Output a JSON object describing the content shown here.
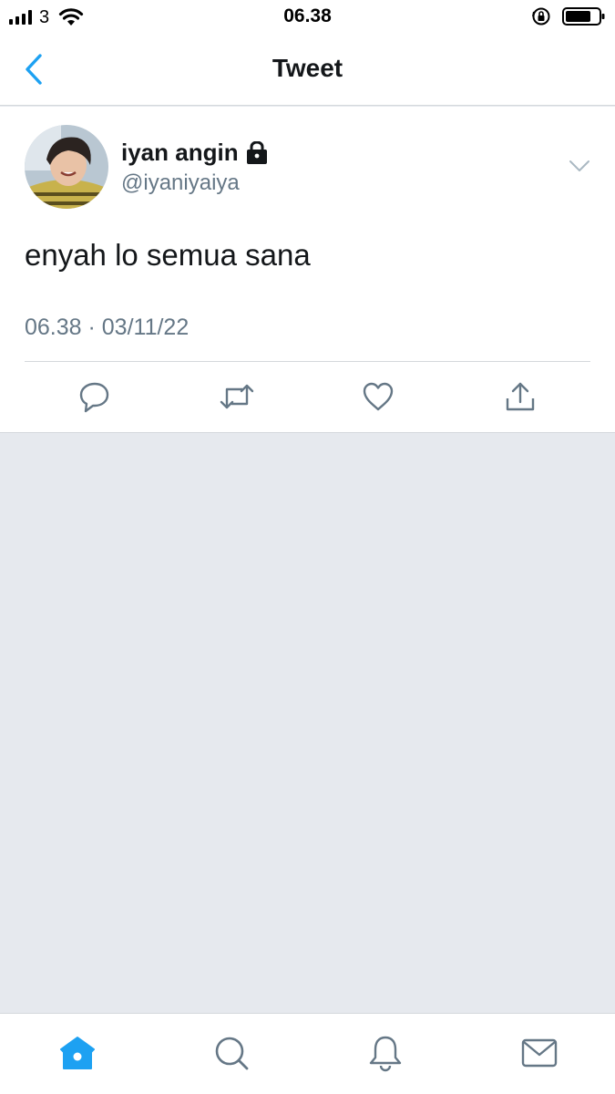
{
  "status_bar": {
    "carrier": "3",
    "time": "06.38"
  },
  "nav": {
    "title": "Tweet",
    "back_icon": "chevron-left-icon"
  },
  "tweet": {
    "display_name": "iyan angin",
    "protected_icon": "lock-icon",
    "handle": "@iyaniyaiya",
    "text": "enyah lo semua sana",
    "timestamp": "06.38 · 03/11/22",
    "actions": [
      "reply-icon",
      "retweet-icon",
      "like-icon",
      "share-icon"
    ]
  },
  "tab_bar": {
    "tabs": [
      "home-icon",
      "search-icon",
      "notifications-icon",
      "messages-icon"
    ],
    "active": "home-icon"
  },
  "colors": {
    "accent": "#1da1f2",
    "text": "#14171a",
    "secondary": "#657786",
    "background": "#e6e9ee",
    "border": "#d4d8dc"
  }
}
